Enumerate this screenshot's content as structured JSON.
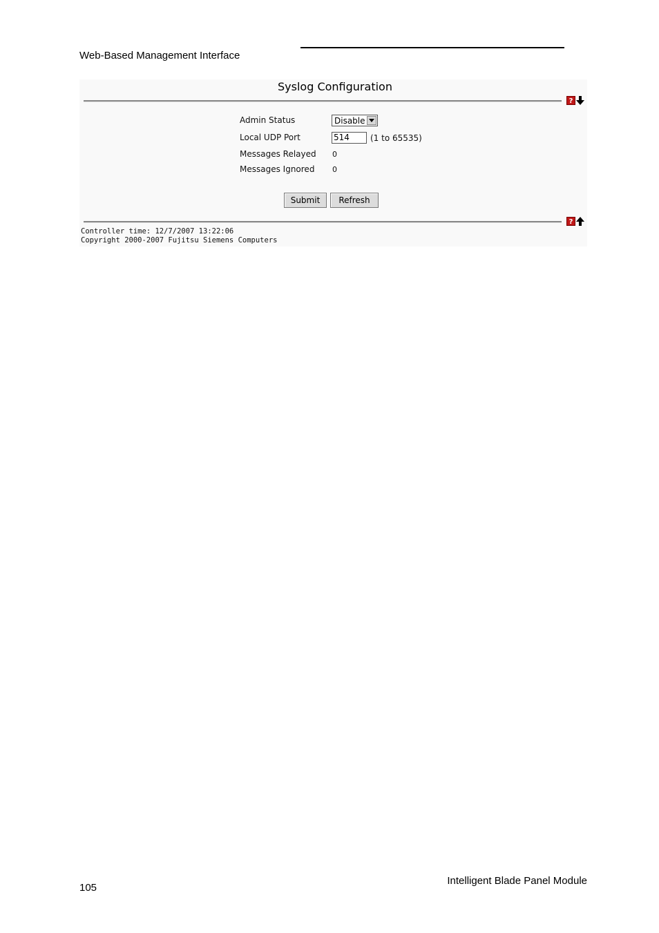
{
  "document": {
    "header_title": "Web-Based Management Interface",
    "footer_title": "Intelligent Blade Panel Module",
    "page_number": "105"
  },
  "panel": {
    "title": "Syslog Configuration",
    "fields": {
      "admin_status": {
        "label": "Admin Status",
        "value": "Disable"
      },
      "local_udp_port": {
        "label": "Local UDP Port",
        "value": "514",
        "hint": "(1 to 65535)"
      },
      "messages_relayed": {
        "label": "Messages Relayed",
        "value": "0"
      },
      "messages_ignored": {
        "label": "Messages Ignored",
        "value": "0"
      }
    },
    "buttons": {
      "submit": "Submit",
      "refresh": "Refresh"
    },
    "help_icon_glyph": "?",
    "footer": {
      "controller_time": "Controller time: 12/7/2007 13:22:06",
      "copyright": "Copyright 2000-2007 Fujitsu Siemens Computers"
    }
  },
  "colors": {
    "help_icon": "#c01818",
    "panel_background": "#f9f9f9"
  }
}
